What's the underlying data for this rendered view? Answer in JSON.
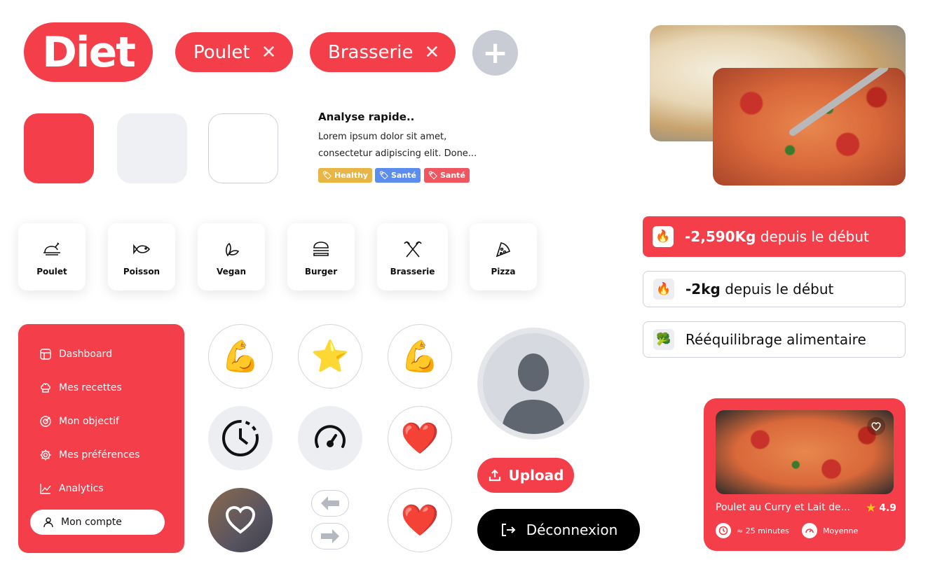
{
  "brand": {
    "logo_text": "Diet",
    "accent": "#f43f4a"
  },
  "filters": {
    "chips": [
      {
        "label": "Poulet",
        "remove_icon": "close-icon"
      },
      {
        "label": "Brasserie",
        "remove_icon": "close-icon"
      }
    ],
    "add_icon": "plus-icon"
  },
  "swatches": [
    "#f43f4a",
    "#eef0f3",
    "#ffffff"
  ],
  "analysis": {
    "title": "Analyse rapide..",
    "text": "Lorem ipsum dolor sit amet, consectetur adipiscing elit. Done...",
    "tags": [
      {
        "label": "Healthy",
        "color": "#e8b547"
      },
      {
        "label": "Santé",
        "color": "#5b8def"
      },
      {
        "label": "Santé",
        "color": "#f0565f"
      }
    ]
  },
  "categories": [
    {
      "label": "Poulet",
      "icon": "chicken-icon"
    },
    {
      "label": "Poisson",
      "icon": "fish-icon"
    },
    {
      "label": "Vegan",
      "icon": "leaf-icon"
    },
    {
      "label": "Burger",
      "icon": "burger-icon"
    },
    {
      "label": "Brasserie",
      "icon": "utensils-icon"
    },
    {
      "label": "Pizza",
      "icon": "pizza-icon"
    }
  ],
  "sidebar": {
    "items": [
      {
        "label": "Dashboard",
        "icon": "dashboard-icon"
      },
      {
        "label": "Mes recettes",
        "icon": "chef-hat-icon"
      },
      {
        "label": "Mon objectif",
        "icon": "target-icon"
      },
      {
        "label": "Mes préférences",
        "icon": "gear-icon"
      },
      {
        "label": "Analytics",
        "icon": "chart-icon"
      }
    ],
    "active": {
      "label": "Mon compte",
      "icon": "user-icon"
    }
  },
  "emoji_buttons": {
    "row1": [
      "💪",
      "⭐",
      "💪"
    ],
    "row2_icons": [
      "clock-icon",
      "speedometer-icon"
    ],
    "row2_emoji": "❤️",
    "row3_emoji": "❤️"
  },
  "profile": {
    "upload_label": "Upload",
    "logout_label": "Déconnexion"
  },
  "stats": [
    {
      "value": "-2,590Kg",
      "text": " depuis le début",
      "icon": "🔥",
      "style": "filled"
    },
    {
      "value": "-2kg",
      "text": " depuis le début",
      "icon": "🔥",
      "style": "outline"
    },
    {
      "value": "",
      "text": "Rééquilibrage alimentaire",
      "icon": "🥦",
      "style": "outline"
    }
  ],
  "recipe_card": {
    "title": "Poulet au Curry et Lait de...",
    "rating": "4.9",
    "duration": "≈ 25 minutes",
    "difficulty": "Moyenne"
  }
}
